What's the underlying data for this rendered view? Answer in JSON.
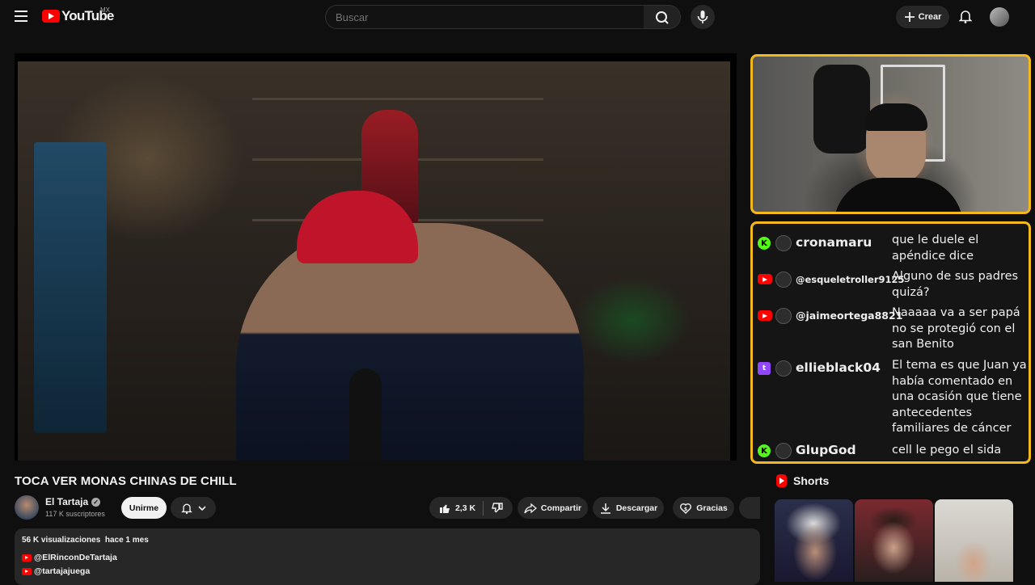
{
  "header": {
    "logo_text": "YouTube",
    "region": "MX",
    "search_placeholder": "Buscar",
    "create_label": "Crear"
  },
  "video": {
    "title": "TOCA VER MONAS CHINAS DE CHILL"
  },
  "channel": {
    "name": "El Tartaja",
    "subscribers": "117 K suscriptores",
    "join_label": "Unirme"
  },
  "actions": {
    "likes": "2,3 K",
    "share_label": "Compartir",
    "download_label": "Descargar",
    "thanks_label": "Gracias"
  },
  "description": {
    "views": "56 K visualizaciones",
    "date": "hace 1 mes",
    "links": [
      "@ElRinconDeTartaja",
      "@tartajajuega"
    ]
  },
  "chat_overlay": {
    "messages": [
      {
        "platform": "kick",
        "user": "cronamaru",
        "text": "que le duele el apéndice dice"
      },
      {
        "platform": "youtube",
        "user": "@esqueletroller9125",
        "text": "Alguno de sus padres quizá?"
      },
      {
        "platform": "youtube",
        "user": "@jaimeortega8821",
        "text": "Naaaaa va a ser papá no se protegió con el san Benito"
      },
      {
        "platform": "twitch",
        "user": "ellieblack04",
        "text": "El tema es que Juan ya había comentado en una ocasión que tiene antecedentes familiares de cáncer"
      },
      {
        "platform": "kick",
        "user": "GlupGod",
        "text": "cell le pego el sida"
      }
    ]
  },
  "shorts": {
    "heading": "Shorts"
  },
  "colors": {
    "overlay_border": "#f3b81b",
    "youtube_red": "#ff0000",
    "kick_green": "#53fc18",
    "twitch_purple": "#9146ff"
  }
}
